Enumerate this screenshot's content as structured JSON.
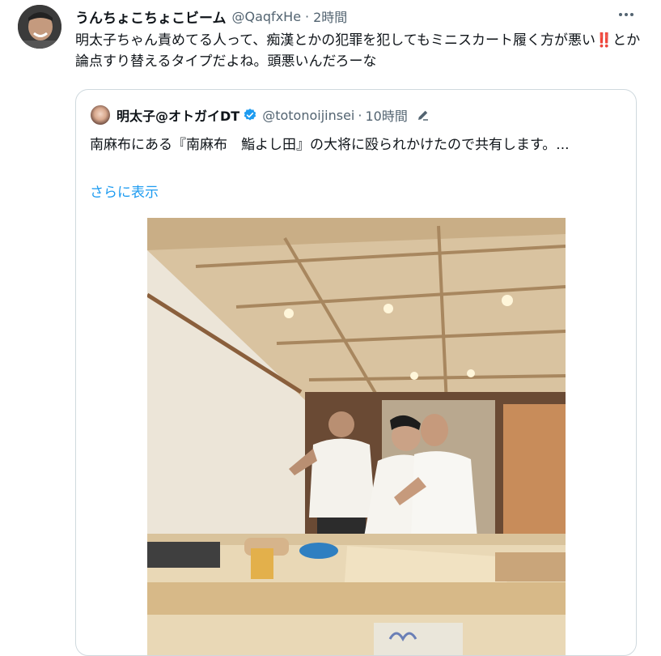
{
  "tweet": {
    "display_name": "うんちょこちょこビーム",
    "handle": "@QaqfxHe",
    "separator": "·",
    "time": "2時間",
    "text_part1": "明太子ちゃん責めてる人って、痴漢とかの犯罪を犯してもミニスカート履く方が悪い",
    "text_emoji": "‼️",
    "text_part2": "とか論点すり替えるタイプだよね。頭悪いんだろーな",
    "more_icon": "more-horizontal-icon"
  },
  "quoted": {
    "display_name": "明太子@オトガイDT",
    "verified_icon": "verified-badge-icon",
    "handle": "@totonoijinsei",
    "separator": "·",
    "time": "10時間",
    "edit_icon": "edited-pencil-icon",
    "text": "南麻布にある『南麻布　鮨よし田』の大将に殴られかけたので共有します。...",
    "show_more": "さらに表示"
  },
  "colors": {
    "link": "#1d9bf0",
    "secondary_text": "#536471",
    "border": "#cfd9de",
    "emoji_red": "#e0245e"
  }
}
